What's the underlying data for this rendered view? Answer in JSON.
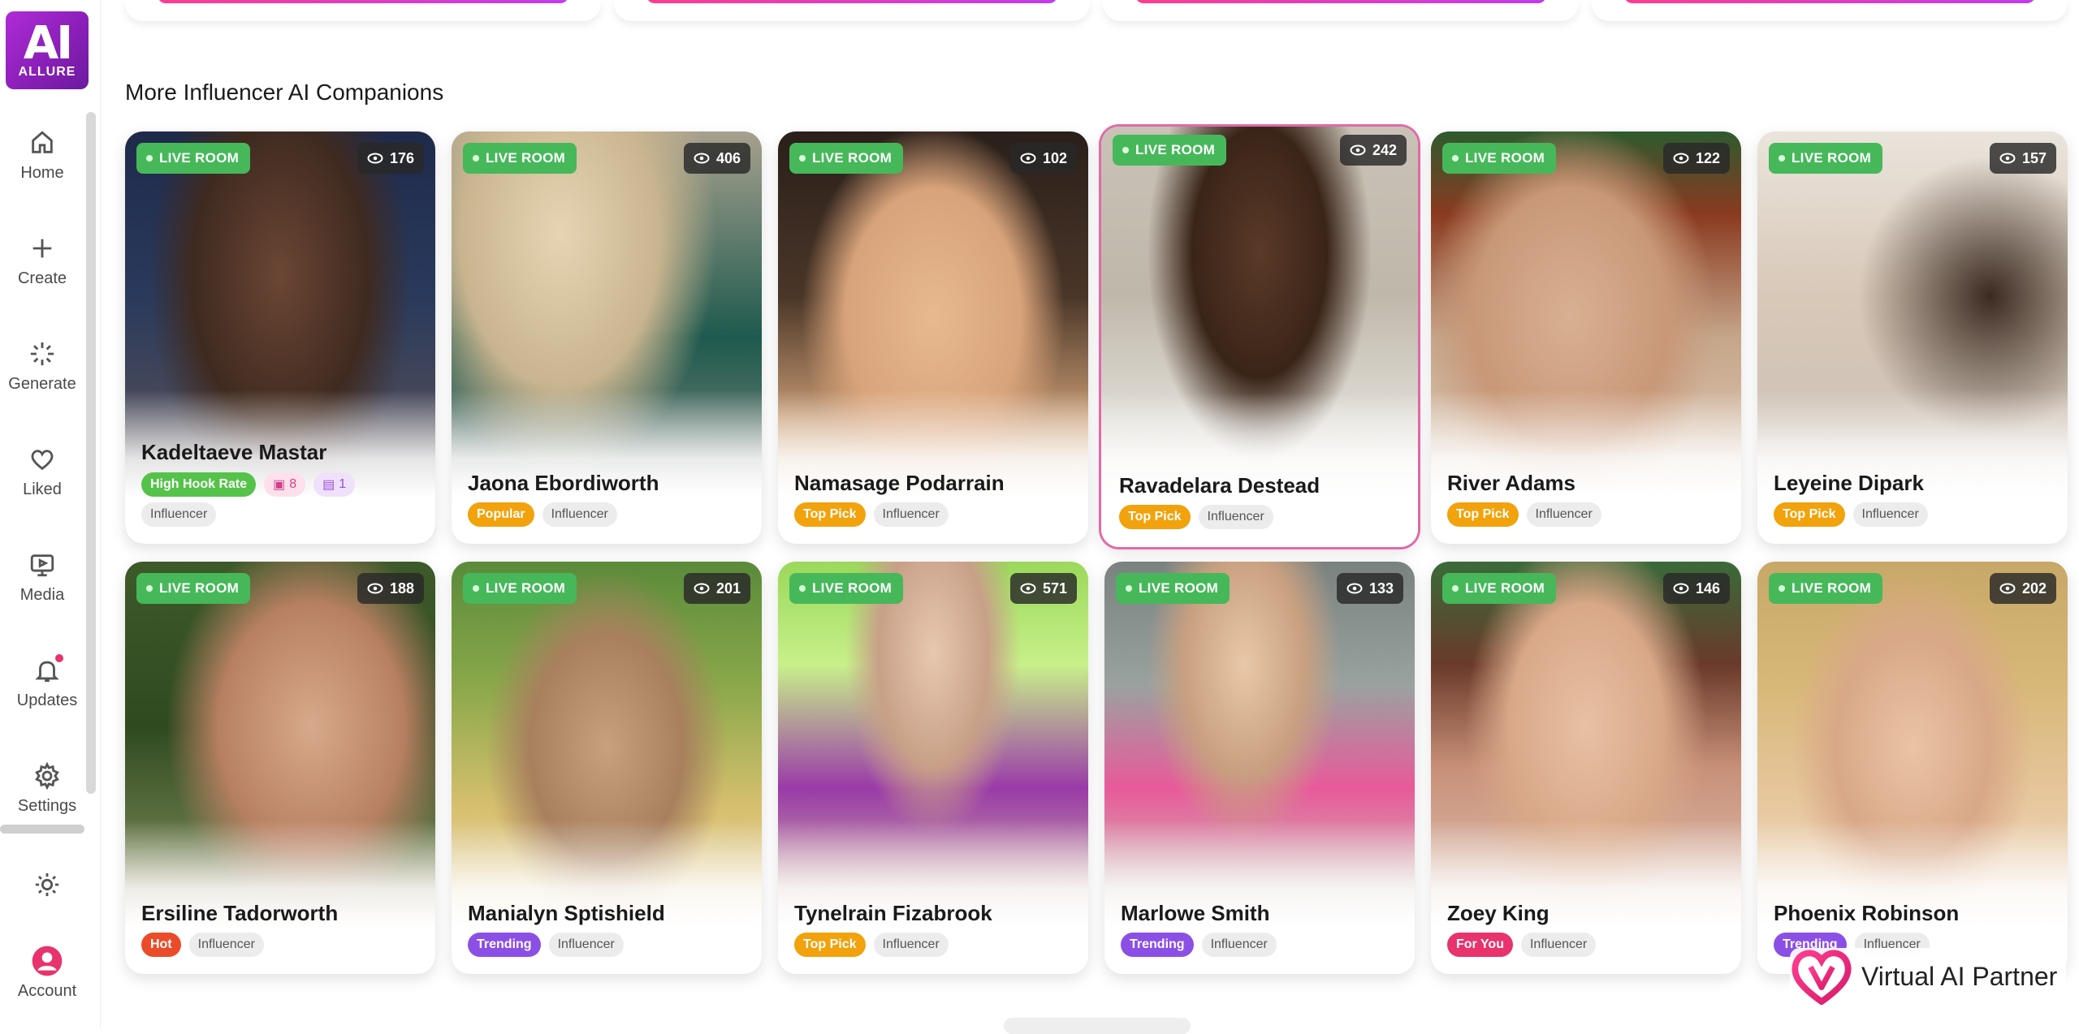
{
  "brand": {
    "logo_main": "AI",
    "logo_sub": "ALLURE"
  },
  "sidebar": {
    "items": [
      {
        "label": "Home",
        "icon": "home-icon"
      },
      {
        "label": "Create",
        "icon": "plus-icon"
      },
      {
        "label": "Generate",
        "icon": "sparkle-icon"
      },
      {
        "label": "Liked",
        "icon": "heart-icon"
      },
      {
        "label": "Media",
        "icon": "media-icon"
      },
      {
        "label": "Updates",
        "icon": "bell-icon"
      },
      {
        "label": "Settings",
        "icon": "gear-icon"
      },
      {
        "label": "",
        "icon": "sun-icon"
      },
      {
        "label": "Account",
        "icon": "avatar-icon"
      }
    ]
  },
  "section": {
    "title": "More Influencer AI Companions"
  },
  "live_label": "LIVE ROOM",
  "cards": [
    {
      "name": "Kadeltaeve Mastar",
      "views": "176",
      "tags": [
        {
          "text": "High Hook Rate",
          "style": "green"
        },
        {
          "text": "8",
          "style": "lpink"
        },
        {
          "text": "1",
          "style": "lpurple"
        }
      ],
      "tags2": [
        {
          "text": "Influencer",
          "style": "gray"
        }
      ]
    },
    {
      "name": "Jaona Ebordiworth",
      "views": "406",
      "tags": [
        {
          "text": "Popular",
          "style": "orange"
        },
        {
          "text": "Influencer",
          "style": "gray"
        }
      ]
    },
    {
      "name": "Namasage Podarrain",
      "views": "102",
      "tags": [
        {
          "text": "Top Pick",
          "style": "orange"
        },
        {
          "text": "Influencer",
          "style": "gray"
        }
      ]
    },
    {
      "name": "Ravadelara Destead",
      "views": "242",
      "tags": [
        {
          "text": "Top Pick",
          "style": "orange"
        },
        {
          "text": "Influencer",
          "style": "gray"
        }
      ]
    },
    {
      "name": "River Adams",
      "views": "122",
      "tags": [
        {
          "text": "Top Pick",
          "style": "orange"
        },
        {
          "text": "Influencer",
          "style": "gray"
        }
      ]
    },
    {
      "name": "Leyeine Dipark",
      "views": "157",
      "tags": [
        {
          "text": "Top Pick",
          "style": "orange"
        },
        {
          "text": "Influencer",
          "style": "gray"
        }
      ]
    },
    {
      "name": "Ersiline Tadorworth",
      "views": "188",
      "tags": [
        {
          "text": "Hot",
          "style": "red"
        },
        {
          "text": "Influencer",
          "style": "gray"
        }
      ]
    },
    {
      "name": "Manialyn Sptishield",
      "views": "201",
      "tags": [
        {
          "text": "Trending",
          "style": "purple"
        },
        {
          "text": "Influencer",
          "style": "gray"
        }
      ]
    },
    {
      "name": "Tynelrain Fizabrook",
      "views": "571",
      "tags": [
        {
          "text": "Top Pick",
          "style": "orange"
        },
        {
          "text": "Influencer",
          "style": "gray"
        }
      ]
    },
    {
      "name": "Marlowe Smith",
      "views": "133",
      "tags": [
        {
          "text": "Trending",
          "style": "purple"
        },
        {
          "text": "Influencer",
          "style": "gray"
        }
      ]
    },
    {
      "name": "Zoey King",
      "views": "146",
      "tags": [
        {
          "text": "For You",
          "style": "pink"
        },
        {
          "text": "Influencer",
          "style": "gray"
        }
      ]
    },
    {
      "name": "Phoenix Robinson",
      "views": "202",
      "tags": [
        {
          "text": "Trending",
          "style": "purple"
        },
        {
          "text": "Influencer",
          "style": "gray"
        }
      ]
    }
  ],
  "partner": {
    "text": "Virtual AI Partner"
  },
  "colors": {
    "brand": "#9b27c9",
    "live_green": "#46b85a",
    "accent_pink": "#e8336d"
  }
}
